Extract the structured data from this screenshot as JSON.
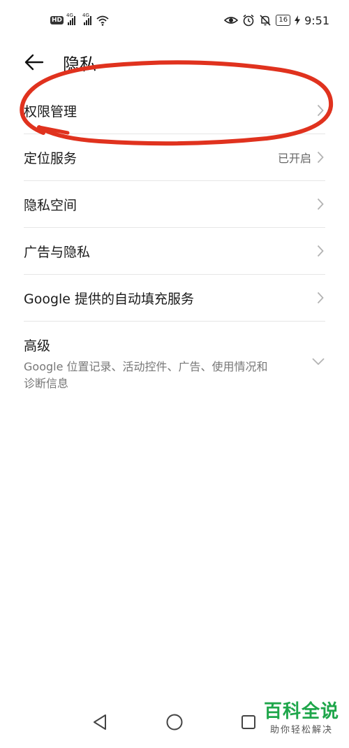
{
  "status_bar": {
    "hd": "HD",
    "sim1_type": "4G",
    "sim2_type": "4G",
    "battery": "16",
    "time": "9:51"
  },
  "header": {
    "title": "隐私"
  },
  "list": {
    "items": [
      {
        "label": "权限管理",
        "value": ""
      },
      {
        "label": "定位服务",
        "value": "已开启"
      },
      {
        "label": "隐私空间",
        "value": ""
      },
      {
        "label": "广告与隐私",
        "value": ""
      },
      {
        "label": "Google 提供的自动填充服务",
        "value": ""
      }
    ],
    "advanced": {
      "title": "高级",
      "description": "Google 位置记录、活动控件、广告、使用情况和诊断信息"
    }
  },
  "watermark": {
    "main": "百科全说",
    "sub": "助你轻松解决"
  },
  "colors": {
    "annotation": "#e0321e",
    "watermark": "#1ea64a"
  }
}
